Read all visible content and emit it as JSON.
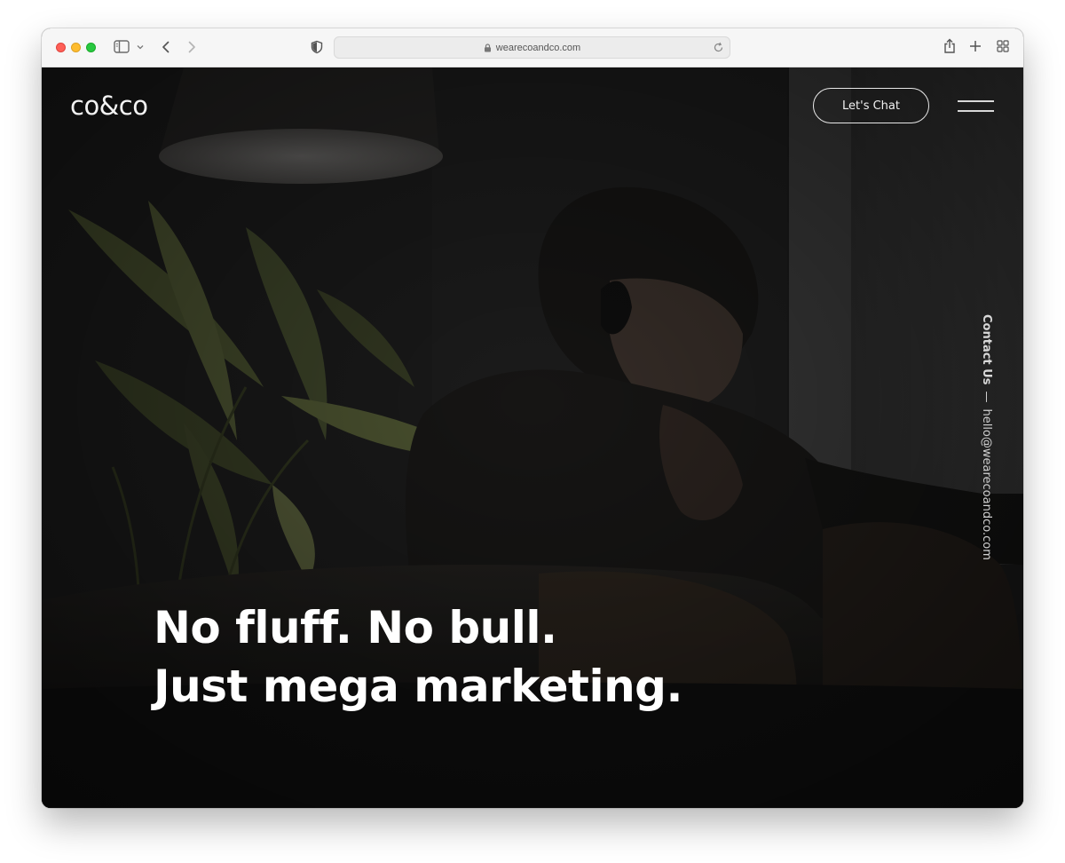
{
  "browser": {
    "url": "wearecoandco.com"
  },
  "site": {
    "logo": "co&co",
    "cta_label": "Let's Chat",
    "contact_label": "Contact Us",
    "contact_dash": "—",
    "contact_email": "hello@wearecoandco.com",
    "headline_line1": "No fluff. No bull.",
    "headline_line2": "Just mega marketing."
  },
  "colors": {
    "page_bg": "#1a1a1a",
    "text": "#ffffff",
    "plant": "#5f6a3c",
    "traffic_red": "#fe5f57",
    "traffic_yellow": "#febc2e",
    "traffic_green": "#28c840"
  },
  "icons": [
    "sidebar-icon",
    "chevron-down-icon",
    "back-arrow-icon",
    "forward-arrow-icon",
    "shield-icon",
    "lock-icon",
    "reload-icon",
    "share-icon",
    "plus-icon",
    "tab-grid-icon",
    "hamburger-menu-icon"
  ]
}
